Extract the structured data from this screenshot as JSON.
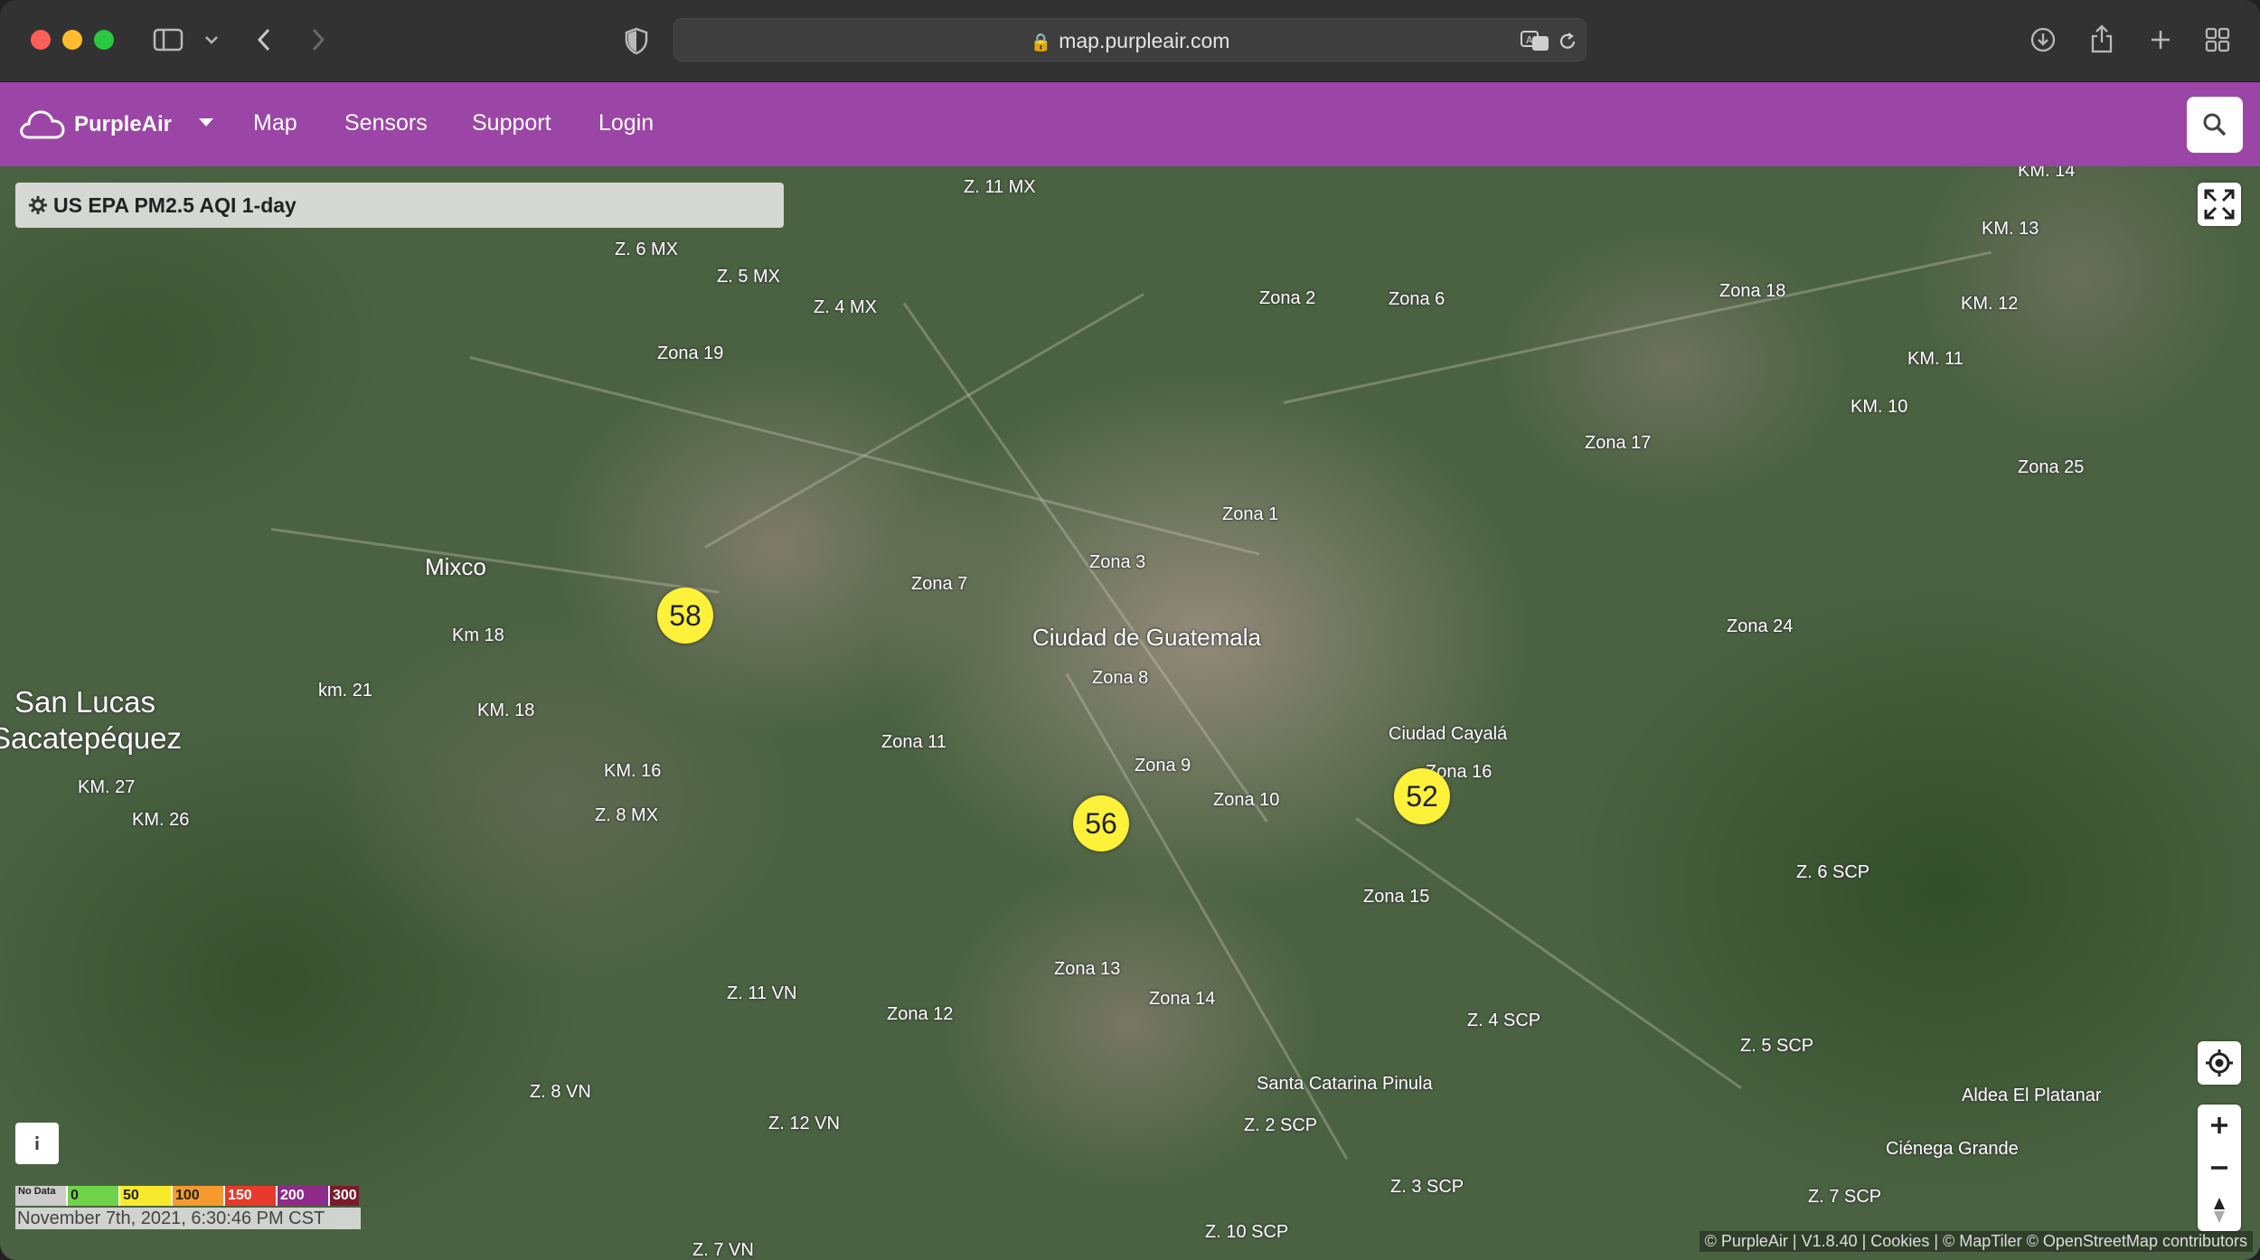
{
  "browser": {
    "url": "map.purpleair.com",
    "icons": [
      "sidebar-icon",
      "chevron-down-icon",
      "back-icon",
      "forward-icon",
      "shield-icon",
      "lock-icon",
      "translate-icon",
      "reload-icon",
      "download-icon",
      "share-icon",
      "new-tab-icon",
      "tab-overview-icon"
    ]
  },
  "nav": {
    "brand": "PurpleAir",
    "links": [
      "Map",
      "Sensors",
      "Support",
      "Login"
    ],
    "accent": "#9b46a6"
  },
  "layer": {
    "label": "US EPA PM2.5 AQI 1-day"
  },
  "markers": [
    "58",
    "56",
    "52"
  ],
  "place_labels": {
    "z11mx": "Z. 11 MX",
    "km14": "KM. 14",
    "z6mx": "Z. 6 MX",
    "z5mx": "Z. 5 MX",
    "z4mx": "Z. 4 MX",
    "km13": "KM. 13",
    "zona2": "Zona 2",
    "zona6": "Zona 6",
    "zona18": "Zona 18",
    "km12": "KM. 12",
    "zona19": "Zona 19",
    "km11": "KM. 11",
    "km10": "KM. 10",
    "zona17": "Zona 17",
    "zona25": "Zona 25",
    "zona1": "Zona 1",
    "mixco": "Mixco",
    "zona3": "Zona 3",
    "zona7": "Zona 7",
    "km18a": "Km 18",
    "ciudad": "Ciudad de Guatemala",
    "zona24": "Zona 24",
    "zona8": "Zona 8",
    "km21": "km. 21",
    "sanlucas1": "San Lucas",
    "sanlucas2": "Sacatepéquez",
    "km18b": "KM. 18",
    "cayala": "Ciudad Cayalá",
    "zona11": "Zona 11",
    "km16": "KM. 16",
    "zona16": "Zona 16",
    "zona9": "Zona 9",
    "km27": "KM. 27",
    "zona10": "Zona 10",
    "z8mx": "Z. 8 MX",
    "km26": "KM. 26",
    "z6scp": "Z. 6 SCP",
    "zona15": "Zona 15",
    "zona13": "Zona 13",
    "z11vn": "Z. 11 VN",
    "zona14": "Zona 14",
    "zona12": "Zona 12",
    "z4scp": "Z. 4 SCP",
    "z5scp": "Z. 5 SCP",
    "stcatarina": "Santa Catarina Pinula",
    "z8vn": "Z. 8 VN",
    "aldea": "Aldea El Platanar",
    "z12vn": "Z. 12 VN",
    "z2scp": "Z. 2 SCP",
    "cienega": "Ciénega Grande",
    "z3scp": "Z. 3 SCP",
    "z7scp": "Z. 7 SCP",
    "z10scp": "Z. 10 SCP",
    "z7vn": "Z. 7 VN"
  },
  "legend": {
    "no_data": "No Data",
    "steps": [
      {
        "label": "0",
        "color": "#6fd34a"
      },
      {
        "label": "50",
        "color": "#f7ea2c"
      },
      {
        "label": "100",
        "color": "#f59a2d"
      },
      {
        "label": "150",
        "color": "#e8392a"
      },
      {
        "label": "200",
        "color": "#8e2a8a"
      },
      {
        "label": "300",
        "color": "#7b1a2a"
      }
    ],
    "timestamp": "November 7th, 2021, 6:30:46 PM CST"
  },
  "attribution": "© PurpleAir | V1.8.40 | Cookies | © MapTiler © OpenStreetMap contributors",
  "colors": {
    "marker": "#fdf13a"
  }
}
